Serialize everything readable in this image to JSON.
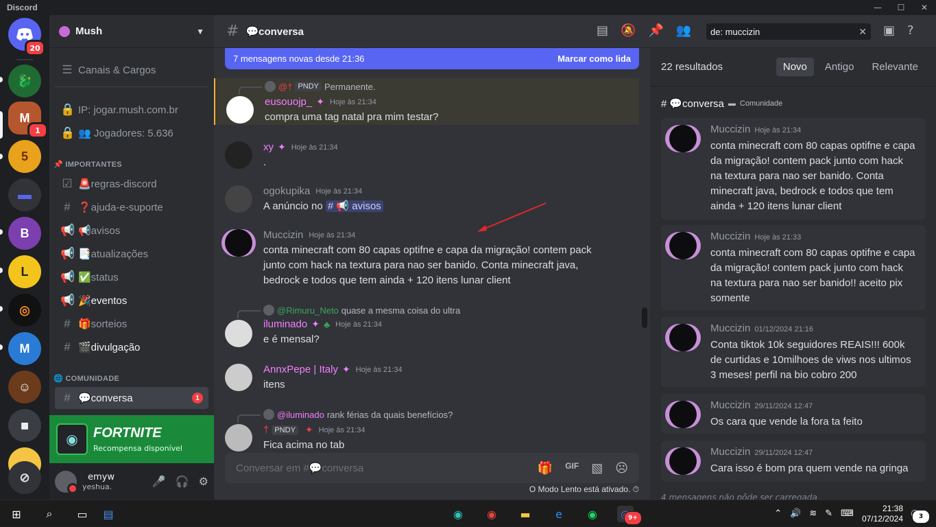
{
  "window": {
    "app_name": "Discord"
  },
  "rail": {
    "home_badge": "20",
    "server2_badge": "1"
  },
  "sidebar": {
    "guild_name": "Mush",
    "items": [
      {
        "label": "Canais & Cargos",
        "icon": "list-icon"
      },
      {
        "label": "IP: jogar.mush.com.br",
        "icon": "lock-icon"
      },
      {
        "label": "👥 Jogadores: 5.636",
        "icon": "lock-icon"
      }
    ],
    "cat_importantes": "📌 IMPORTANTES",
    "importantes": [
      {
        "label": "🚨regras-discord",
        "icon": "rules-icon"
      },
      {
        "label": "❓ajuda-e-suporte",
        "icon": "hash-icon"
      },
      {
        "label": "📢avisos",
        "icon": "megaphone-icon"
      },
      {
        "label": "📑atualizações",
        "icon": "megaphone-icon"
      },
      {
        "label": "✅status",
        "icon": "megaphone-icon"
      },
      {
        "label": "🎉eventos",
        "icon": "megaphone-icon"
      },
      {
        "label": "🎁sorteios",
        "icon": "hash-icon"
      },
      {
        "label": "🎬divulgação",
        "icon": "hash-icon"
      }
    ],
    "cat_comunidade": "🌐 COMUNIDADE",
    "selected_channel": "💬conversa",
    "selected_badge": "1",
    "promo_title": "FORTNITE",
    "promo_sub": "Recompensa disponível",
    "user_name": "emyw",
    "user_status": "yeshua."
  },
  "header": {
    "channel": "💬conversa",
    "search_value": "de: muccizin"
  },
  "chat": {
    "newbar_text": "7 mensagens novas desde 21:36",
    "newbar_action": "Marcar como lida",
    "messages": [
      {
        "reply_user": "@†",
        "reply_tag": "PNDY",
        "reply_text": "Permanente.",
        "name": "eusouojp_",
        "time": "Hoje às 21:34",
        "text": "compra uma tag natal pra mim testar?"
      },
      {
        "name": "xy",
        "time": "Hoje às 21:34",
        "text": "."
      },
      {
        "name": "ogokupika",
        "time": "Hoje às 21:34",
        "text_pre": "A anúncio no ",
        "mention": "# 📢 avisos"
      },
      {
        "name": "Muccizin",
        "time": "Hoje às 21:34",
        "text": "conta minecraft com 80 capas optifne e capa da migração! contem pack junto com hack na textura para nao ser banido. Conta minecraft java, bedrock e todos que tem ainda + 120 itens lunar client"
      },
      {
        "reply_user": "@Rimuru_Neto",
        "reply_text": "quase a mesma coisa do ultra",
        "name": "iluminado",
        "time": "Hoje às 21:34",
        "text": "e é mensal?"
      },
      {
        "name": "AnnxPepe | Italy",
        "time": "Hoje às 21:34",
        "text": "itens"
      },
      {
        "reply_user": "@iluminado",
        "reply_text": "rank férias da quais benefícios?",
        "name": "†",
        "tag": "PNDY",
        "time": "Hoje às 21:34",
        "text": "Fica acima no tab"
      }
    ],
    "composer_placeholder": "Conversar em #💬conversa",
    "slow_mode": "O Modo Lento está ativado."
  },
  "results": {
    "count": "22 resultados",
    "tabs": [
      "Novo",
      "Antigo",
      "Relevante"
    ],
    "channel": "💬conversa",
    "channel_cat": "Comunidade",
    "items": [
      {
        "name": "Muccizin",
        "time": "Hoje às 21:34",
        "text": "conta minecraft com 80 capas optifne e capa da migração! contem pack junto com hack na textura para nao ser banido. Conta minecraft java, bedrock e todos que tem ainda + 120 itens lunar client"
      },
      {
        "name": "Muccizin",
        "time": "Hoje às 21:33",
        "text": "conta minecraft com 80 capas optifne e capa da migração! contem pack junto com hack na textura para nao ser banido!! aceito pix somente"
      },
      {
        "name": "Muccizin",
        "time": "01/12/2024 21:16",
        "text": "Conta tiktok 10k seguidores REAIS!!! 600k de curtidas e 10milhoes de viws nos ultimos 3 meses! perfil na bio cobro 200"
      },
      {
        "name": "Muccizin",
        "time": "29/11/2024 12:47",
        "text": "Os cara que vende la fora ta feito"
      },
      {
        "name": "Muccizin",
        "time": "29/11/2024 12:47",
        "text": "Cara isso é bom pra quem vende na gringa"
      }
    ],
    "more": "4 mensagens não pôde ser carregada"
  },
  "taskbar": {
    "time": "21:38",
    "date": "07/12/2024",
    "notif": "3",
    "discord_badge": "9+"
  }
}
